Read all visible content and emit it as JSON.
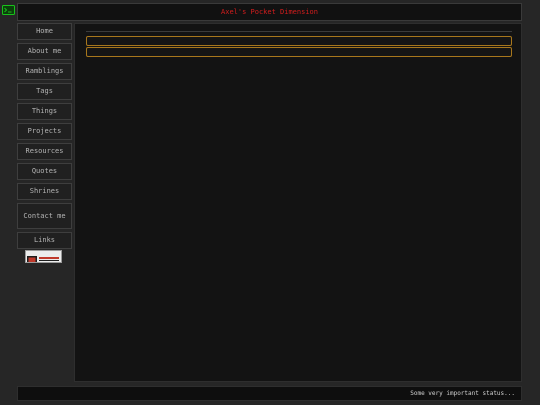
{
  "header": {
    "title": "Axel's Pocket Dimension"
  },
  "nav": {
    "items": [
      {
        "label": "Home"
      },
      {
        "label": "About me"
      },
      {
        "label": "Ramblings"
      },
      {
        "label": "Tags"
      },
      {
        "label": "Things"
      },
      {
        "label": "Projects"
      },
      {
        "label": "Resources"
      },
      {
        "label": "Quotes"
      },
      {
        "label": "Shrines"
      },
      {
        "label": "Contact me"
      },
      {
        "label": "Links"
      }
    ]
  },
  "badge": {
    "icon": "88x31-button-icon"
  },
  "logo": {
    "icon": "terminal-logo-icon",
    "color": "#18c21a"
  },
  "status": {
    "text": "Some very important status..."
  },
  "colors": {
    "background": "#262626",
    "title_red": "#d21d1d",
    "accent_gold": "#a8771c",
    "panel": "#131313"
  }
}
